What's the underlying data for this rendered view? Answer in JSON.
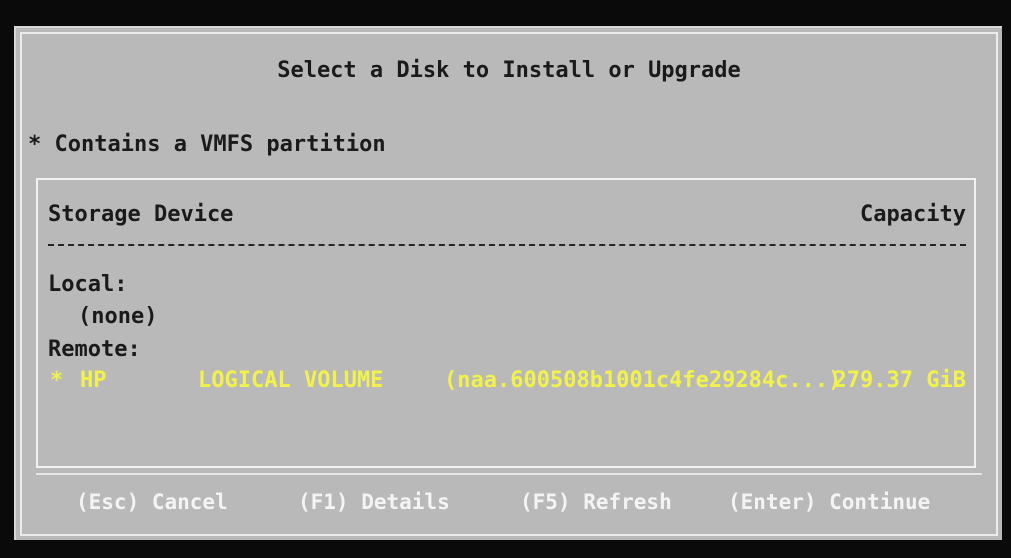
{
  "dialog": {
    "title": "Select a Disk to Install or Upgrade",
    "vmfs_note": "* Contains a VMFS partition"
  },
  "table": {
    "columns": {
      "device": "Storage Device",
      "capacity": "Capacity"
    },
    "local_label": "Local:",
    "local_none": "(none)",
    "remote_label": "Remote:",
    "remote_devices": [
      {
        "marker": "*",
        "vendor": "HP",
        "model": "LOGICAL VOLUME",
        "id": "(naa.600508b1001c4fe29284c...)",
        "capacity": "279.37 GiB"
      }
    ]
  },
  "footer": {
    "cancel": "(Esc) Cancel",
    "details": "(F1) Details",
    "refresh": "(F5) Refresh",
    "continue": "(Enter) Continue"
  },
  "colors": {
    "background": "#b9b9b9",
    "selected_text": "#f2f24a",
    "footer_text": "#f4f4f4"
  }
}
